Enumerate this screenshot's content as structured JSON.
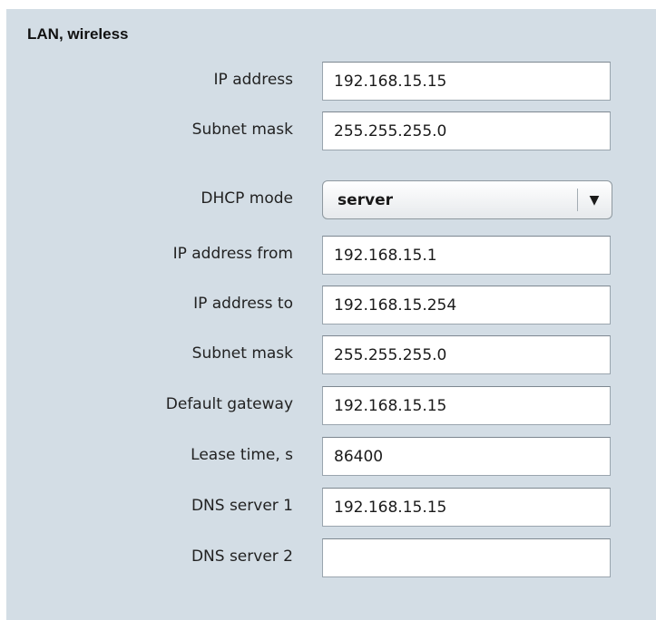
{
  "section": {
    "title": "LAN, wireless"
  },
  "fields": [
    {
      "label": "IP address",
      "value": "192.168.15.15"
    },
    {
      "label": "Subnet mask",
      "value": "255.255.255.0"
    }
  ],
  "dhcp": {
    "label": "DHCP mode",
    "selected": "server",
    "arrow_icon": "▼"
  },
  "dhcp_fields": [
    {
      "label": "IP address from",
      "value": "192.168.15.1"
    },
    {
      "label": "IP address to",
      "value": "192.168.15.254"
    },
    {
      "label": "Subnet mask",
      "value": "255.255.255.0"
    },
    {
      "label": "Default gateway",
      "value": "192.168.15.15"
    },
    {
      "label": "Lease time, s",
      "value": "86400"
    },
    {
      "label": "DNS server 1",
      "value": "192.168.15.15"
    },
    {
      "label": "DNS server 2",
      "value": ""
    }
  ],
  "colors": {
    "panel_background": "#d3dde5",
    "field_background": "#ffffff",
    "field_border": "#9aa5ae"
  }
}
